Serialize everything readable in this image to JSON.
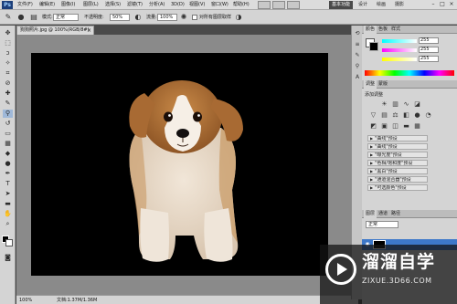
{
  "menubar": {
    "logo": "Ps",
    "items": [
      "文件(F)",
      "编辑(E)",
      "图像(I)",
      "图层(L)",
      "选择(S)",
      "滤镜(T)",
      "分析(A)",
      "3D(D)",
      "视图(V)",
      "窗口(W)",
      "帮助(H)"
    ],
    "modes": [
      "基本功能",
      "设计",
      "绘画",
      "摄影"
    ],
    "window_buttons": [
      "–",
      "□",
      "×"
    ]
  },
  "options": {
    "mode_label": "模式:",
    "mode_value": "正常",
    "opacity_label": "不透明度:",
    "opacity_value": "50%",
    "flow_label": "流量:",
    "flow_value": "100%",
    "sample_label": "对所有图层取样"
  },
  "document": {
    "tab_title": "狗狗照片.jpg @ 100%(RGB/8#)",
    "status_zoom": "100%",
    "status_doc": "文档:1.37M/1.36M"
  },
  "panels": {
    "color_tabs": [
      "颜色",
      "色板",
      "样式"
    ],
    "rgb_values": [
      "255",
      "255",
      "255"
    ],
    "adjust_tabs": [
      "调整",
      "蒙版"
    ],
    "adjust_title": "添加调整",
    "presets": [
      "\"曲线\"预设",
      "\"曲线\"预设",
      "\"曝光度\"预设",
      "\"色相/饱和度\"预设",
      "\"黑白\"预设",
      "\"通道混合器\"预设",
      "\"可选颜色\"预设"
    ],
    "layer_tabs": [
      "图层",
      "通道",
      "路径"
    ],
    "blend_mode": "正常"
  },
  "watermark": {
    "brand": "溜溜自学",
    "url": "ZIXUE.3D66.COM"
  }
}
